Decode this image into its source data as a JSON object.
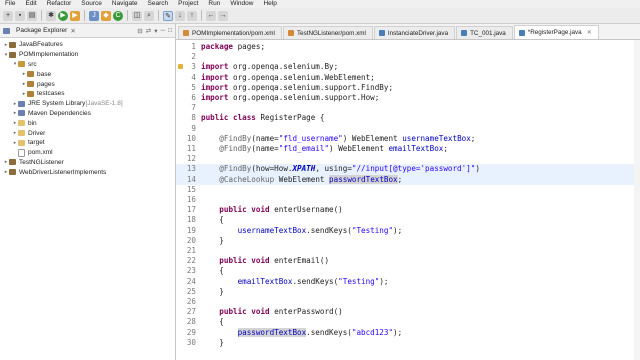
{
  "menu": [
    "File",
    "Edit",
    "Refactor",
    "Source",
    "Navigate",
    "Search",
    "Project",
    "Run",
    "Window",
    "Help"
  ],
  "toolbar_icons": [
    "new-icon",
    "save-icon",
    "print-icon",
    "debug-icon",
    "run-icon",
    "external-tools-icon",
    "new-java-project-icon",
    "new-package-icon",
    "new-class-icon",
    "open-type-icon",
    "search-icon",
    "toggle-mark-icon",
    "back-icon",
    "forward-icon"
  ],
  "explorer": {
    "title": "Package Explorer",
    "tree": [
      {
        "label": "JavaBFeatures",
        "depth": 0,
        "toggle": "▸",
        "icon": "proj"
      },
      {
        "label": "POMImplementation",
        "depth": 0,
        "toggle": "▾",
        "icon": "proj"
      },
      {
        "label": "src",
        "depth": 1,
        "toggle": "▾",
        "icon": "src"
      },
      {
        "label": "base",
        "depth": 2,
        "toggle": "▸",
        "icon": "pkg"
      },
      {
        "label": "pages",
        "depth": 2,
        "toggle": "▸",
        "icon": "pkg"
      },
      {
        "label": "testcases",
        "depth": 2,
        "toggle": "▸",
        "icon": "pkg"
      },
      {
        "label": "JRE System Library",
        "suffix": " [JavaSE-1.8]",
        "depth": 1,
        "toggle": "▸",
        "icon": "lib"
      },
      {
        "label": "Maven Dependencies",
        "depth": 1,
        "toggle": "▸",
        "icon": "lib"
      },
      {
        "label": "bin",
        "depth": 1,
        "toggle": "▸",
        "icon": "folder"
      },
      {
        "label": "Driver",
        "depth": 1,
        "toggle": "▸",
        "icon": "folder"
      },
      {
        "label": "target",
        "depth": 1,
        "toggle": "▸",
        "icon": "folder"
      },
      {
        "label": "pom.xml",
        "depth": 1,
        "toggle": "",
        "icon": "file"
      },
      {
        "label": "TestNGListener",
        "depth": 0,
        "toggle": "▸",
        "icon": "proj"
      },
      {
        "label": "WebDriverListenerImplements",
        "depth": 0,
        "toggle": "▸",
        "icon": "proj"
      }
    ]
  },
  "editor_tabs": [
    {
      "label": "POMImplementation/pom.xml",
      "icon": "xml",
      "active": false
    },
    {
      "label": "TestNGListener/pom.xml",
      "icon": "xml",
      "active": false
    },
    {
      "label": "InstanciateDriver.java",
      "icon": "java",
      "active": false
    },
    {
      "label": "TC_001.java",
      "icon": "java",
      "active": false
    },
    {
      "label": "*RegisterPage.java",
      "icon": "java",
      "active": true
    }
  ],
  "code_lines": [
    {
      "n": "1",
      "html": "<span class='kw'>package</span> pages;"
    },
    {
      "n": "2",
      "html": ""
    },
    {
      "n": "3",
      "html": "<span class='kw'>import</span> org.openqa.selenium.By;",
      "mark": true
    },
    {
      "n": "4",
      "html": "<span class='kw'>import</span> org.openqa.selenium.WebElement;"
    },
    {
      "n": "5",
      "html": "<span class='kw'>import</span> org.openqa.selenium.support.FindBy;"
    },
    {
      "n": "6",
      "html": "<span class='kw'>import</span> org.openqa.selenium.support.How;"
    },
    {
      "n": "7",
      "html": ""
    },
    {
      "n": "8",
      "html": "<span class='kw'>public class</span> RegisterPage {"
    },
    {
      "n": "9",
      "html": ""
    },
    {
      "n": "10",
      "html": "    <span class='an'>@FindBy</span>(name=<span class='st'>\"fld_username\"</span>) WebElement <span class='fd'>usernameTextBox</span>;"
    },
    {
      "n": "11",
      "html": "    <span class='an'>@FindBy</span>(name=<span class='st'>\"fld_email\"</span>) WebElement <span class='fd'>emailTextBox</span>;"
    },
    {
      "n": "12",
      "html": ""
    },
    {
      "n": "13",
      "html": "    <span class='an'>@FindBy</span>(how=How.<span class='it'>XPATH</span>, using=<span class='st'>\"//input[@type='password']\"</span>)",
      "hl": true
    },
    {
      "n": "14",
      "html": "    <span class='an'>@CacheLookup</span> WebElement <span class='fd sel'>passwordTextBox</span>;",
      "hl": true
    },
    {
      "n": "15",
      "html": ""
    },
    {
      "n": "16",
      "html": ""
    },
    {
      "n": "17",
      "html": "    <span class='kw'>public void</span> enterUsername()"
    },
    {
      "n": "18",
      "html": "    {"
    },
    {
      "n": "19",
      "html": "        <span class='fd'>usernameTextBox</span>.sendKeys(<span class='st'>\"Testing\"</span>);"
    },
    {
      "n": "20",
      "html": "    }"
    },
    {
      "n": "21",
      "html": ""
    },
    {
      "n": "22",
      "html": "    <span class='kw'>public void</span> enterEmail()"
    },
    {
      "n": "23",
      "html": "    {"
    },
    {
      "n": "24",
      "html": "        <span class='fd'>emailTextBox</span>.sendKeys(<span class='st'>\"Testing\"</span>);"
    },
    {
      "n": "25",
      "html": "    }"
    },
    {
      "n": "26",
      "html": ""
    },
    {
      "n": "27",
      "html": "    <span class='kw'>public void</span> enterPassword()"
    },
    {
      "n": "28",
      "html": "    {"
    },
    {
      "n": "29",
      "html": "        <span class='fd sel'>passwordTextBox</span>.sendKeys(<span class='st'>\"abcd123\"</span>);"
    },
    {
      "n": "30",
      "html": "    }"
    }
  ]
}
